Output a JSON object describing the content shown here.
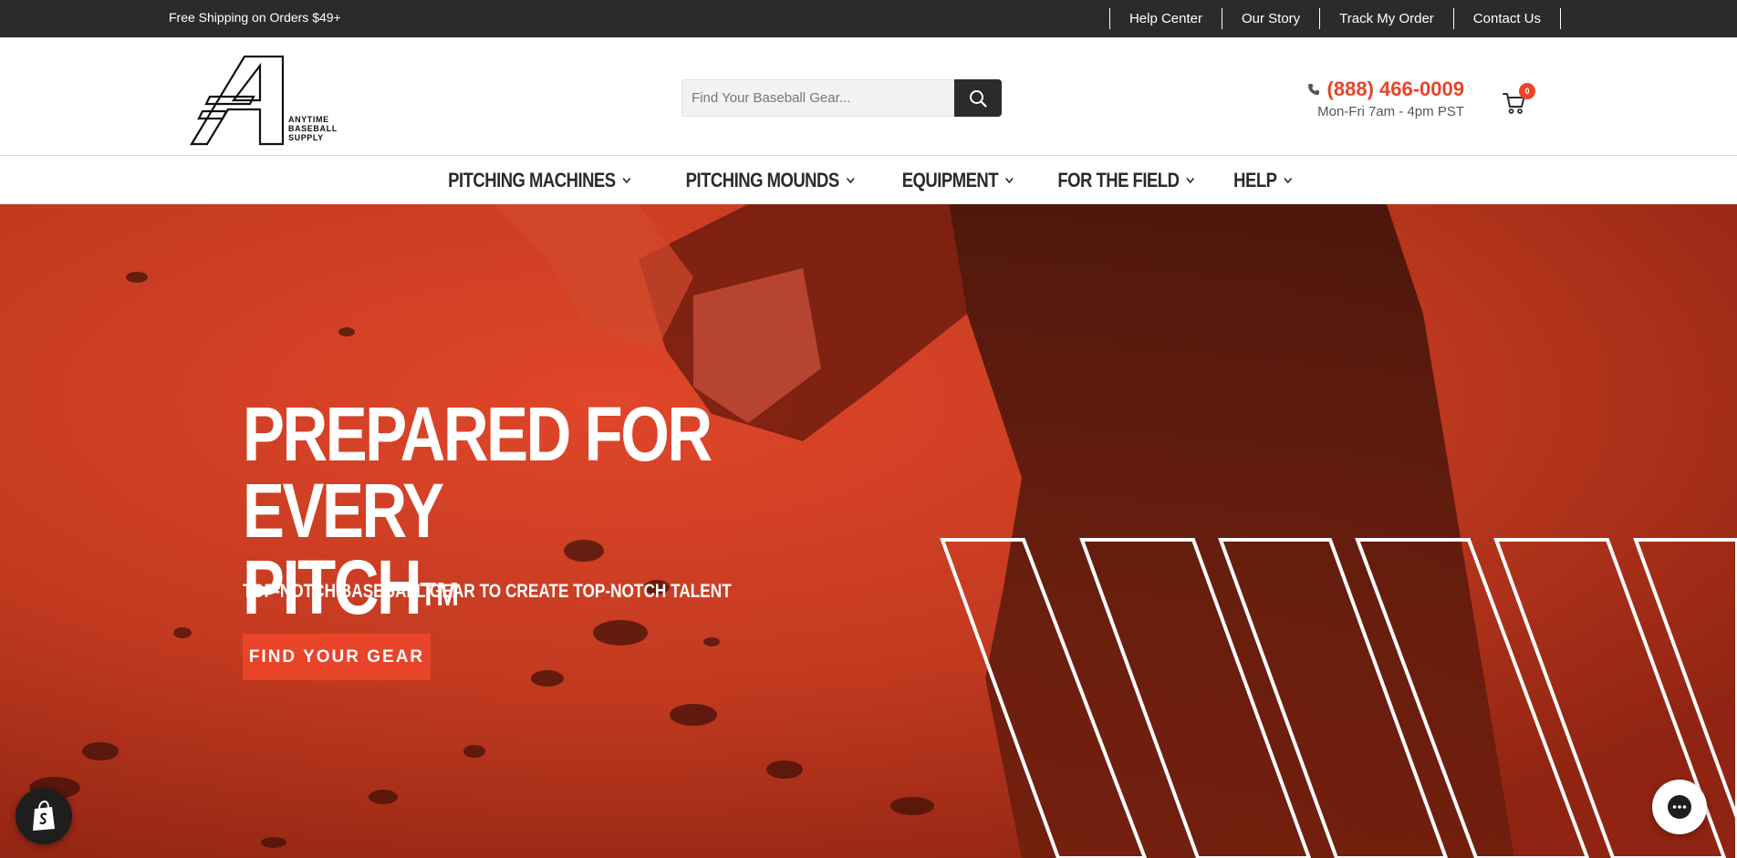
{
  "announcement": {
    "promo_text": "Free Shipping on Orders $49+",
    "links": [
      "Help Center",
      "Our Story",
      "Track My Order",
      "Contact Us"
    ]
  },
  "header": {
    "logo_text": "ANYTIME BASEBALL SUPPLY",
    "search_placeholder": "Find Your Baseball Gear...",
    "phone": "(888) 466-0009",
    "hours": "Mon-Fri 7am - 4pm PST",
    "cart_count": "0"
  },
  "nav": {
    "items": [
      "PITCHING MACHINES",
      "PITCHING MOUNDS",
      "EQUIPMENT",
      "FOR THE FIELD",
      "HELP"
    ]
  },
  "hero": {
    "headline_line1": "PREPARED FOR EVERY",
    "headline_line2": "PITCH",
    "headline_mark": "TM",
    "subheadline": "TOP-NOTCH BASEBALL GEAR TO CREATE TOP-NOTCH TALENT",
    "cta_label": "FIND YOUR GEAR"
  },
  "colors": {
    "accent": "#e8442a",
    "dark": "#2b2b2b",
    "hero_red": "#c4341d"
  },
  "icons": {
    "search": "search-icon",
    "phone": "phone-icon",
    "cart": "cart-icon",
    "nav_chevron": "chevron-down-icon",
    "shopify": "shopify-bag-icon",
    "chat": "chat-bubble-icon"
  }
}
